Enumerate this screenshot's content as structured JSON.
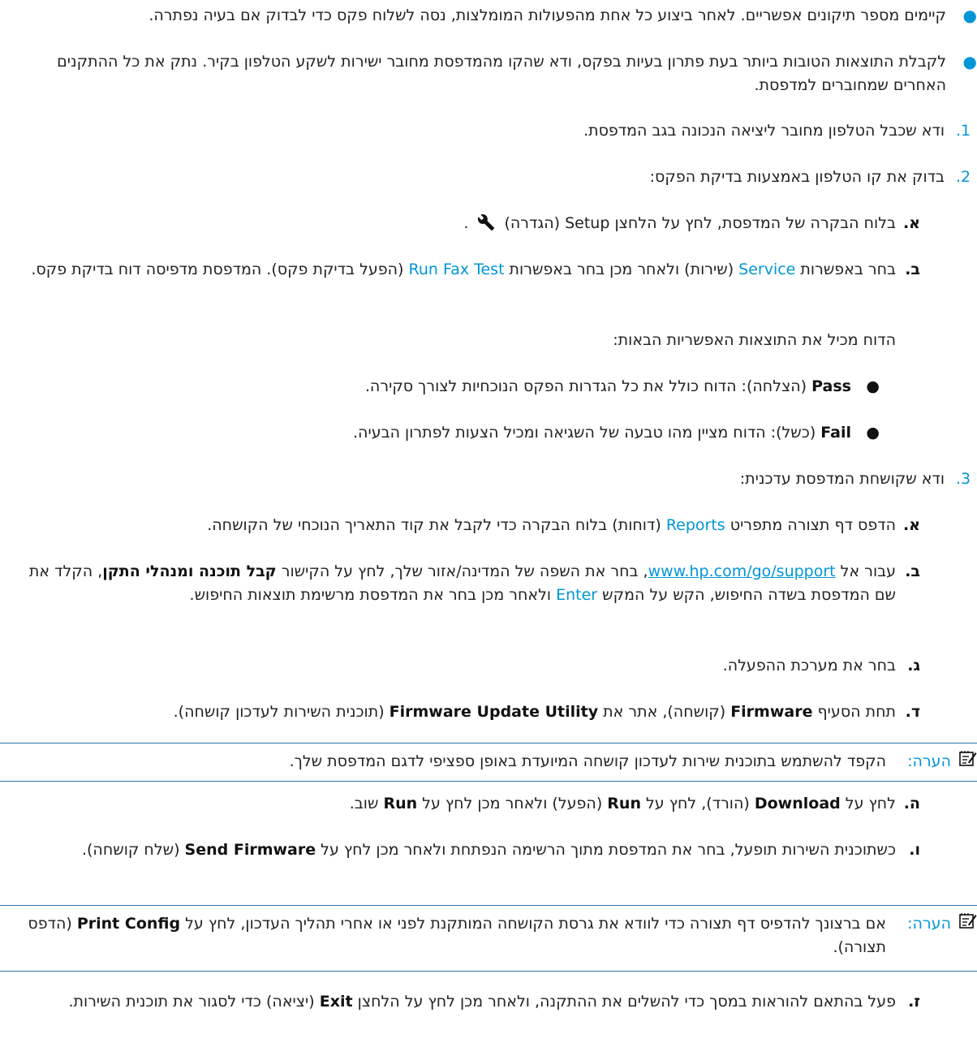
{
  "top_bullets": [
    "קיימים מספר תיקונים אפשריים. לאחר ביצוע כל אחת מהפעולות המומלצות, נסה לשלוח פקס כדי לבדוק אם בעיה נפתרה.",
    "לקבלת התוצאות הטובות ביותר בעת פתרון בעיות בפקס, ודא שהקו מהמדפסת מחובר ישירות לשקע הטלפון בקיר. נתק את כל ההתקנים האחרים שמחוברים למדפסת."
  ],
  "step1": {
    "num": "1.",
    "text": "ודא שכבל הטלפון מחובר ליציאה הנכונה בגב המדפסת."
  },
  "step2": {
    "num": "2.",
    "text": "בדוק את קו הטלפון באמצעות בדיקת הפקס:",
    "a": {
      "letter": "א.",
      "pre": "בלוח הבקרה של המדפסת, לחץ על הלחצן Setup (הגדרה)",
      "post": "."
    },
    "b": {
      "letter": "ב.",
      "p1": "בחר באפשרות ",
      "service": "Service",
      "p2": " (שירות) ולאחר מכן בחר באפשרות ",
      "run_fax_test": "Run Fax Test",
      "p3": " (הפעל בדיקת פקס). המדפסת מדפיסה דוח בדיקת פקס."
    },
    "results_intro": "הדוח מכיל את התוצאות האפשריות הבאות:",
    "pass": {
      "term": "Pass",
      "rest": " (הצלחה): הדוח כולל את כל הגדרות הפקס הנוכחיות לצורך סקירה."
    },
    "fail": {
      "term": "Fail",
      "rest": " (כשל): הדוח מציין מהו טבעה של השגיאה ומכיל הצעות לפתרון הבעיה."
    }
  },
  "step3": {
    "num": "3.",
    "text": "ודא שקושחת המדפסת עדכנית:",
    "a": {
      "letter": "א.",
      "p1": "הדפס דף תצורה מתפריט ",
      "reports": "Reports",
      "p2": " (דוחות) בלוח הבקרה כדי לקבל את קוד התאריך הנוכחי של הקושחה."
    },
    "b": {
      "letter": "ב.",
      "p1": "עבור אל ",
      "url": "www.hp.com/go/support",
      "p2": ", בחר את השפה של המדינה/אזור שלך, לחץ על הקישור ",
      "bold_link": "קבל תוכנה ומנהלי התקן",
      "p3": ", הקלד את שם המדפסת בשדה החיפוש, הקש על המקש ",
      "enter": "Enter",
      "p4": " ולאחר מכן בחר את המדפסת מרשימת תוצאות החיפוש."
    },
    "c": {
      "letter": "ג.",
      "text": "בחר את מערכת ההפעלה."
    },
    "d": {
      "letter": "ד.",
      "p1": "תחת הסעיף ",
      "firmware": "Firmware",
      "p2": " (קושחה), אתר את ",
      "utility": "Firmware Update Utility",
      "p3": " (תוכנית השירות לעדכון קושחה)."
    },
    "note1": {
      "label": "הערה:",
      "text": "הקפד להשתמש בתוכנית שירות לעדכון קושחה המיועדת באופן ספציפי לדגם המדפסת שלך."
    },
    "e": {
      "letter": "ה.",
      "p1": "לחץ על ",
      "download": "Download",
      "p2": " (הורד), לחץ על ",
      "run": "Run",
      "p3": " (הפעל) ולאחר מכן לחץ על ",
      "run2": "Run",
      "p4": " שוב."
    },
    "f": {
      "letter": "ו.",
      "p1": "כשתוכנית השירות תופעל, בחר את המדפסת מתוך הרשימה הנפתחת ולאחר מכן לחץ על ",
      "send_firmware": "Send Firmware",
      "p2": " (שלח קושחה)."
    },
    "note2": {
      "label": "הערה:",
      "p1": "אם ברצונך להדפיס דף תצורה כדי לוודא את גרסת הקושחה המותקנת לפני או אחרי תהליך העדכון, לחץ על ",
      "print_config": "Print Config",
      "p2": " (הדפס תצורה)."
    },
    "g": {
      "letter": "ז.",
      "p1": "פעל בהתאם להוראות במסך כדי להשלים את ההתקנה, ולאחר מכן לחץ על הלחצן ",
      "exit": "Exit",
      "p2": " (יציאה) כדי לסגור את תוכנית השירות."
    }
  },
  "icons": {
    "bullet": "●",
    "wrench": "wrench-icon",
    "note": "note-icon"
  },
  "colors": {
    "accent": "#0096d6",
    "rule": "#2a78a8",
    "text": "#222222"
  }
}
